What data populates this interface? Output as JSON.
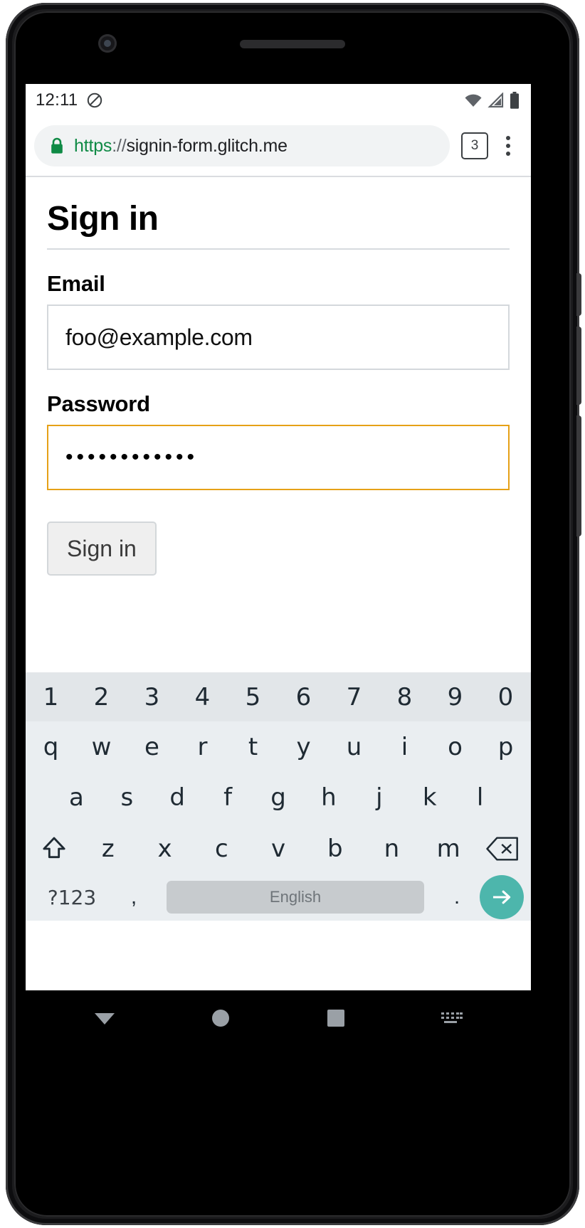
{
  "status_bar": {
    "time": "12:11",
    "icons": [
      "dnd-icon",
      "wifi-icon",
      "signal-icon",
      "battery-icon"
    ]
  },
  "browser": {
    "url_scheme": "https",
    "url_separator": "://",
    "url_host": "signin-form.glitch.me",
    "url_full": "https://signin-form.glitch.me",
    "lock_icon": "lock-icon",
    "tab_count": "3",
    "menu_icon": "overflow-menu-icon"
  },
  "page": {
    "title": "Sign in",
    "fields": [
      {
        "label": "Email",
        "value": "foo@example.com",
        "focused": false
      },
      {
        "label": "Password",
        "value": "••••••••••••",
        "focused": true
      }
    ],
    "submit_label": "Sign in"
  },
  "keyboard": {
    "number_row": [
      "1",
      "2",
      "3",
      "4",
      "5",
      "6",
      "7",
      "8",
      "9",
      "0"
    ],
    "top_row": [
      "q",
      "w",
      "e",
      "r",
      "t",
      "y",
      "u",
      "i",
      "o",
      "p"
    ],
    "home_row": [
      "a",
      "s",
      "d",
      "f",
      "g",
      "h",
      "j",
      "k",
      "l"
    ],
    "bottom_row": [
      "z",
      "x",
      "c",
      "v",
      "b",
      "n",
      "m"
    ],
    "shift_icon": "shift-icon",
    "backspace_icon": "backspace-icon",
    "symbols_label": "?123",
    "comma_label": ",",
    "space_label": "English",
    "period_label": ".",
    "enter_icon": "enter-arrow-icon"
  },
  "nav_bar": {
    "back_icon": "back-icon",
    "home_icon": "home-icon",
    "recents_icon": "recents-icon",
    "hide_keyboard_icon": "hide-keyboard-icon"
  },
  "colors": {
    "focus_border": "#e6a117",
    "enter_key": "#4db6ac",
    "url_scheme": "#0f8a45"
  }
}
